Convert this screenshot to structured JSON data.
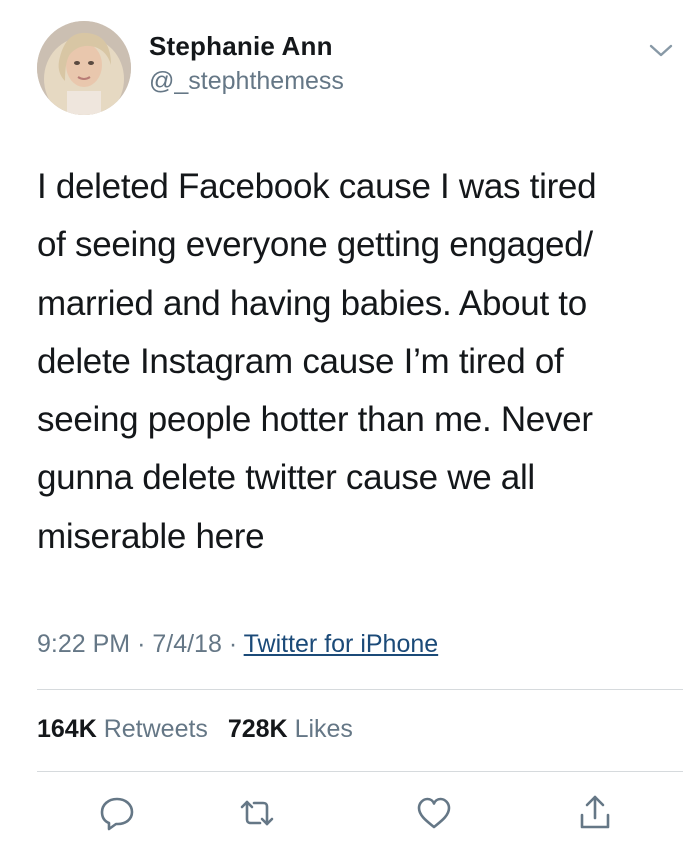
{
  "author": {
    "name": "Stephanie Ann",
    "handle": "@_stephthemess"
  },
  "tweet": {
    "text": "I deleted Facebook cause I was tired\nof seeing everyone getting engaged/\nmarried and having babies. About to\ndelete Instagram cause I’m tired of\nseeing people hotter than me. Never\ngunna delete twitter cause we all\nmiserable here",
    "time": "9:22 PM",
    "date": "7/4/18",
    "separator": "·",
    "source": "Twitter for iPhone"
  },
  "stats": {
    "retweets_count": "164K",
    "retweets_label": "Retweets",
    "likes_count": "728K",
    "likes_label": "Likes"
  },
  "actions": [
    {
      "icon": "reply-icon"
    },
    {
      "icon": "retweet-icon"
    },
    {
      "icon": "like-icon"
    },
    {
      "icon": "share-icon"
    }
  ],
  "colors": {
    "text": "#14171a",
    "secondary": "#657786",
    "link": "#1b4a78",
    "divider": "#d6dadd"
  }
}
